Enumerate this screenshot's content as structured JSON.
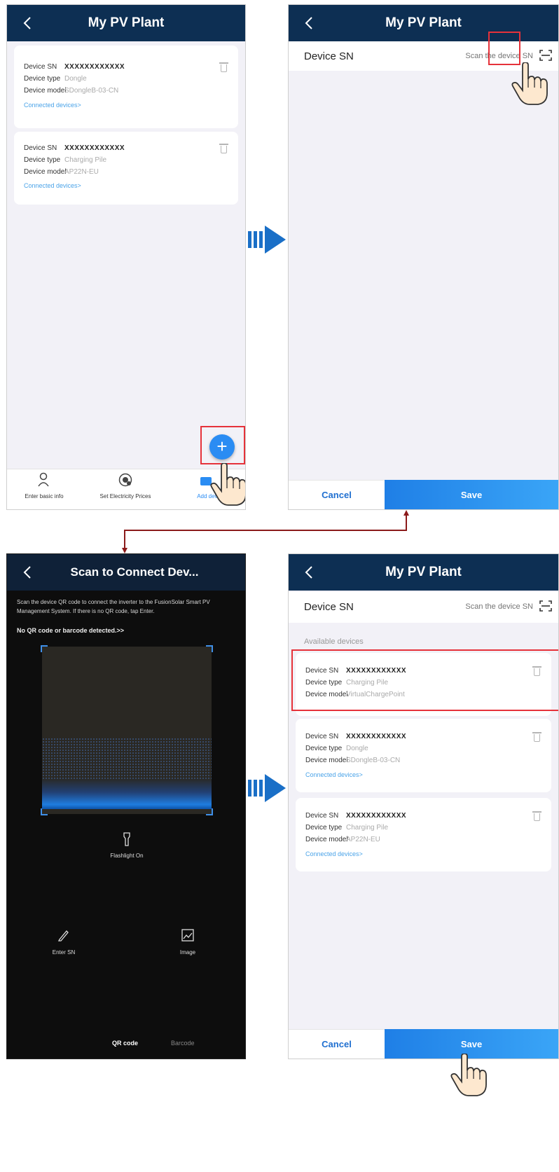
{
  "colors": {
    "header": "#0d2f53",
    "accent": "#2a8cf3",
    "highlight": "#e6323a",
    "link": "#4aa3e8",
    "connector": "#8b1a1a",
    "arrow": "#1a6fc7"
  },
  "screen1": {
    "title": "My PV Plant",
    "devices": [
      {
        "sn_label": "Device SN",
        "sn": "XXXXXXXXXXXX",
        "type_label": "Device type",
        "type": "Dongle",
        "model_label": "Device model",
        "model": "SDongleB-03-CN",
        "link": "Connected devices>"
      },
      {
        "sn_label": "Device SN",
        "sn": "XXXXXXXXXXXX",
        "type_label": "Device type",
        "type": "Charging Pile",
        "model_label": "Device model",
        "model": "AP22N-EU",
        "link": "Connected devices>"
      }
    ],
    "nav": {
      "basic": "Enter basic info",
      "prices": "Set Electricity Prices",
      "add": "Add device"
    }
  },
  "screen2": {
    "title": "My PV Plant",
    "sn_label": "Device SN",
    "placeholder": "Scan the device SN",
    "cancel": "Cancel",
    "save": "Save"
  },
  "screen3": {
    "title": "Scan to Connect Dev...",
    "desc": "Scan the device QR code to connect the inverter to the FusionSolar Smart PV Management System. If there is no QR code, tap Enter.",
    "no_code": "No QR code or barcode detected.>>",
    "flashlight": "Flashlight On",
    "enter_sn": "Enter SN",
    "image": "Image",
    "qr_tab": "QR code",
    "barcode_tab": "Barcode"
  },
  "screen4": {
    "title": "My PV Plant",
    "sn_label": "Device SN",
    "placeholder": "Scan the device SN",
    "available": "Available devices",
    "devices": [
      {
        "sn_label": "Device SN",
        "sn": "XXXXXXXXXXXX",
        "type_label": "Device type",
        "type": "Charging Pile",
        "model_label": "Device model",
        "model": "VirtualChargePoint",
        "link": ""
      },
      {
        "sn_label": "Device SN",
        "sn": "XXXXXXXXXXXX",
        "type_label": "Device type",
        "type": "Dongle",
        "model_label": "Device model",
        "model": "SDongleB-03-CN",
        "link": "Connected devices>"
      },
      {
        "sn_label": "Device SN",
        "sn": "XXXXXXXXXXXX",
        "type_label": "Device type",
        "type": "Charging Pile",
        "model_label": "Device model",
        "model": "AP22N-EU",
        "link": "Connected devices>"
      }
    ],
    "cancel": "Cancel",
    "save": "Save"
  }
}
